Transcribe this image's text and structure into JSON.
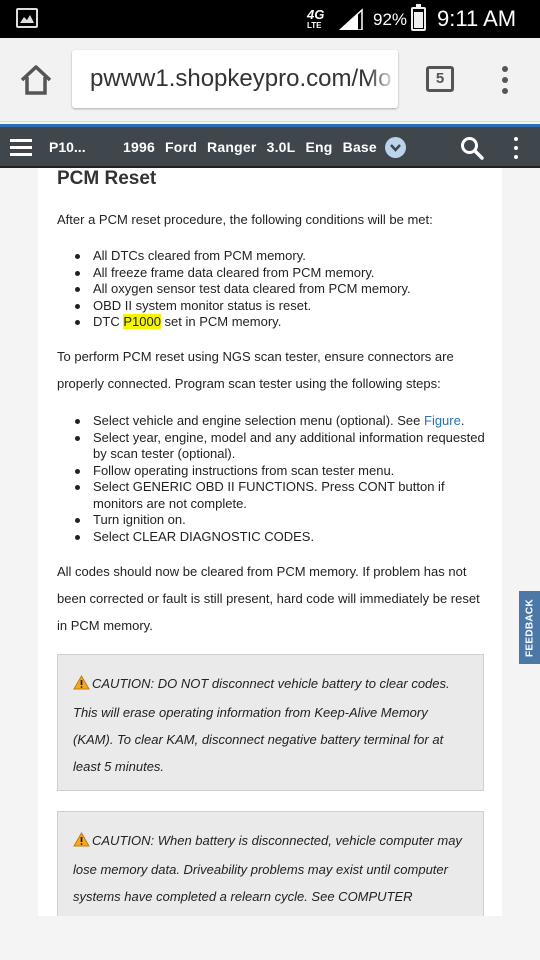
{
  "status_bar": {
    "network": "4G",
    "network_sub": "LTE",
    "battery_percent": "92%",
    "battery_level": 0.92,
    "time": "9:11 AM"
  },
  "browser": {
    "url": "pwww1.shopkeypro.com/Mo",
    "tab_count": "5",
    "icons": [
      "home-icon",
      "tabs-icon",
      "overflow-menu-icon"
    ]
  },
  "app_bar": {
    "code": "P10...",
    "vehicle_parts": [
      "1996",
      "Ford",
      "Ranger",
      "3.0L",
      "Eng",
      "Base"
    ],
    "icons": [
      "hamburger-icon",
      "chevron-down-icon",
      "search-icon",
      "kebab-icon"
    ],
    "accent_color": "#2b6fb0"
  },
  "article": {
    "title": "PCM Reset",
    "intro": "After a PCM reset procedure, the following conditions will be met:",
    "conditions": [
      "All DTCs cleared from PCM memory.",
      "All freeze frame data cleared from PCM memory.",
      "All oxygen sensor test data cleared from PCM memory.",
      "OBD II system monitor status is reset."
    ],
    "dtc_prefix": "DTC ",
    "dtc_code": "P1000",
    "dtc_suffix": " set in PCM memory.",
    "ngs_intro": "To perform PCM reset using NGS scan tester, ensure connectors are properly connected. Program scan tester using the following steps:",
    "step1_text": "Select vehicle and engine selection menu (optional). See ",
    "step1_link": "Figure",
    "step1_end": ".",
    "steps": [
      "Select year, engine, model and any additional information requested by scan tester (optional).",
      "Follow operating instructions from scan tester menu.",
      "Select GENERIC OBD II FUNCTIONS. Press CONT button if monitors are not complete.",
      "Turn ignition on.",
      "Select CLEAR DIAGNOSTIC CODES."
    ],
    "closing": "All codes should now be cleared from PCM memory. If problem has not been corrected or fault is still present, hard code will immediately be reset in PCM memory.",
    "caution1": "CAUTION: DO NOT  disconnect vehicle battery to clear codes. This will erase operating information from Keep-Alive Memory (KAM). To clear KAM, disconnect negative battery terminal for at least 5 minutes.",
    "caution2": "CAUTION: When battery is disconnected, vehicle computer may lose memory data. Driveability problems may exist until computer systems have completed a relearn cycle. See COMPUTER RELEARN PROCEDURES article in the GENERAL INFORMATION before"
  },
  "feedback_label": "FEEDBACK",
  "colors": {
    "highlight": "#f5f500",
    "link": "#2a71b8",
    "feedback_tab": "#4b78a7"
  }
}
